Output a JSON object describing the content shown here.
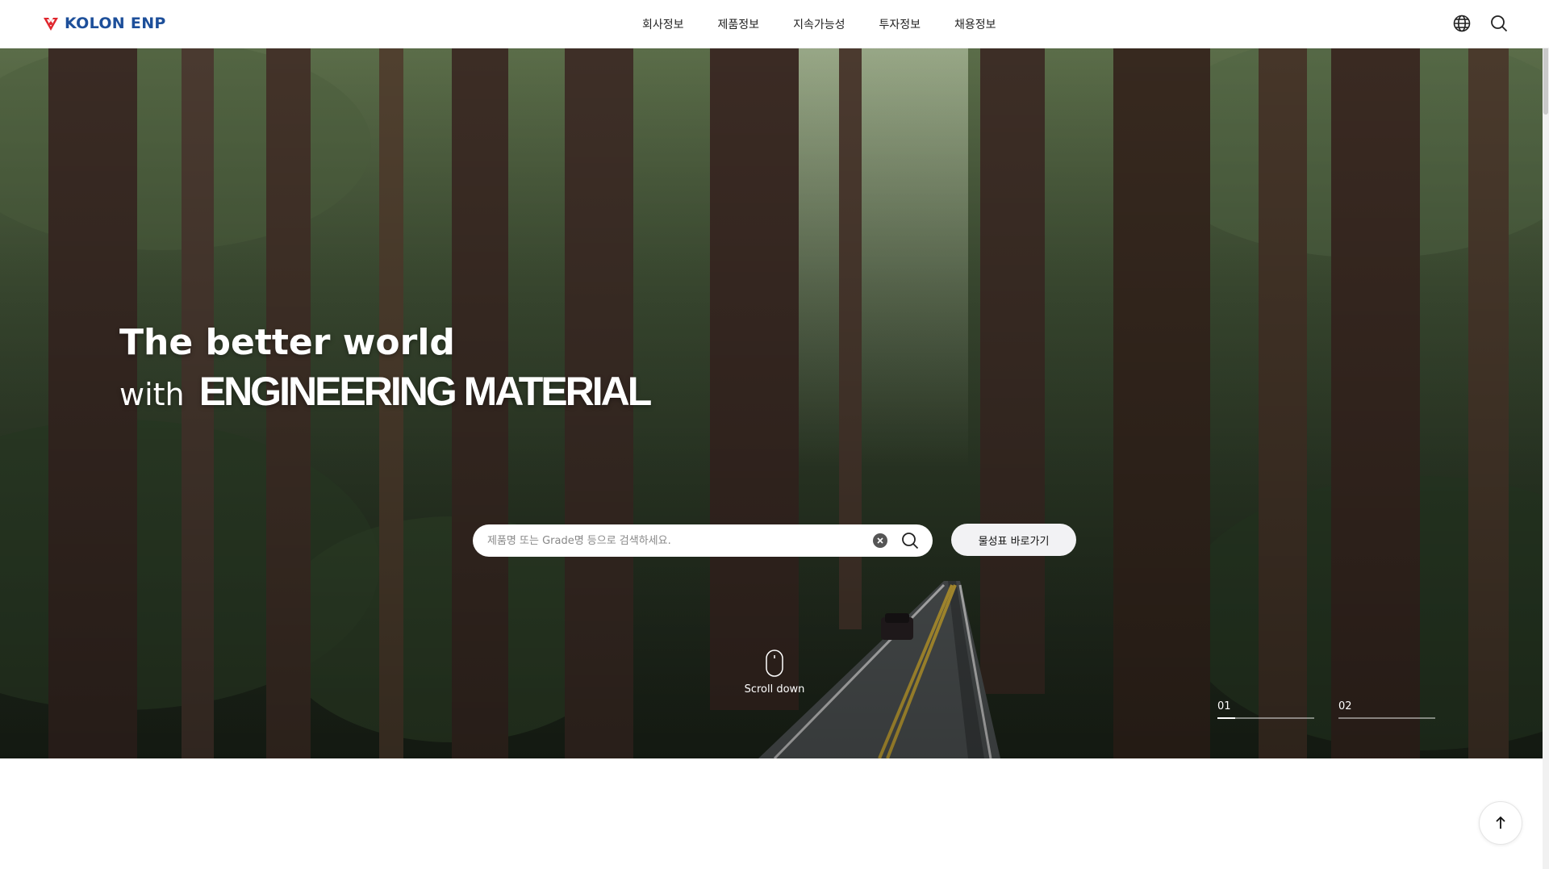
{
  "header": {
    "logo_text": "KOLON ENP",
    "nav": [
      "회사정보",
      "제품정보",
      "지속가능성",
      "투자정보",
      "채용정보"
    ],
    "icons": [
      "globe-icon",
      "search-icon"
    ]
  },
  "hero": {
    "title": "The better world",
    "subtitle_prefix": "with",
    "subtitle_emphasis": "ENGINEERING MATERIAL",
    "search_placeholder": "제품명 또는 Grade명 등으로 검색하세요.",
    "spec_button_label": "물성표 바로가기",
    "scroll_label": "Scroll down",
    "slides": [
      {
        "label": "01",
        "active": true,
        "progress": 0.18
      },
      {
        "label": "02",
        "active": false,
        "progress": 0
      }
    ]
  },
  "colors": {
    "brand_blue": "#1d4f9a",
    "brand_red": "#e0262d"
  }
}
